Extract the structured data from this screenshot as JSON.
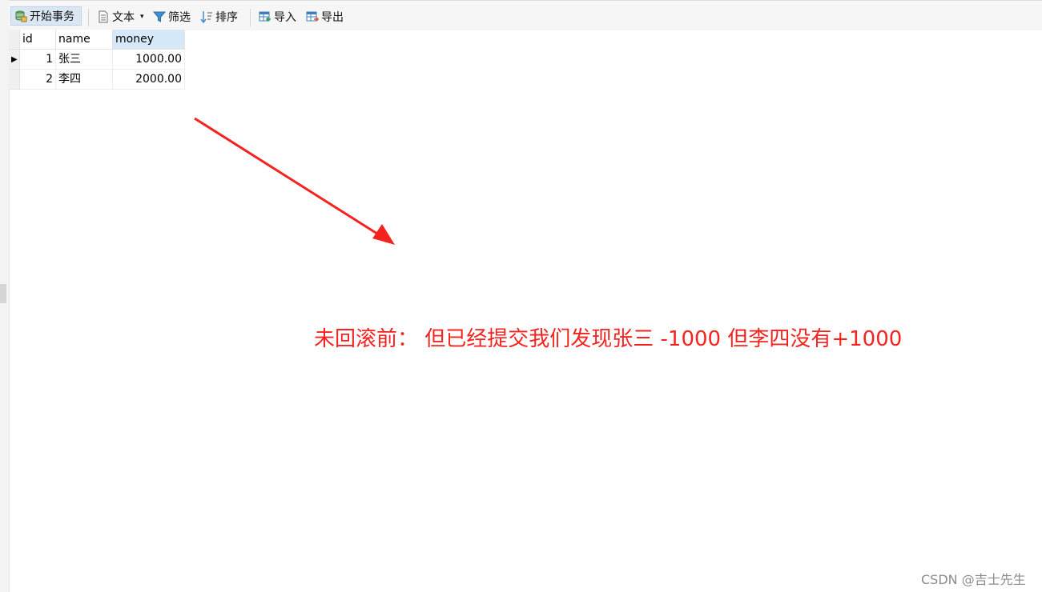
{
  "toolbar": {
    "begin_transaction": "开始事务",
    "text": "文本",
    "filter": "筛选",
    "sort": "排序",
    "import": "导入",
    "export": "导出"
  },
  "table": {
    "columns": [
      "id",
      "name",
      "money"
    ],
    "rows": [
      {
        "id": "1",
        "name": "张三",
        "money": "1000.00"
      },
      {
        "id": "2",
        "name": "李四",
        "money": "2000.00"
      }
    ]
  },
  "annotation": "未回滚前： 但已经提交我们发现张三 -1000 但李四没有+1000",
  "watermark": "CSDN @吉士先生",
  "colors": {
    "annotation": "#f4231f",
    "selected_header": "#d7e8f8"
  },
  "icons": [
    "transaction-icon",
    "text-doc-icon",
    "dropdown-arrow-icon",
    "filter-funnel-icon",
    "sort-icon",
    "import-table-icon",
    "export-table-icon",
    "row-pointer-icon",
    "arrow-annotation-icon"
  ]
}
